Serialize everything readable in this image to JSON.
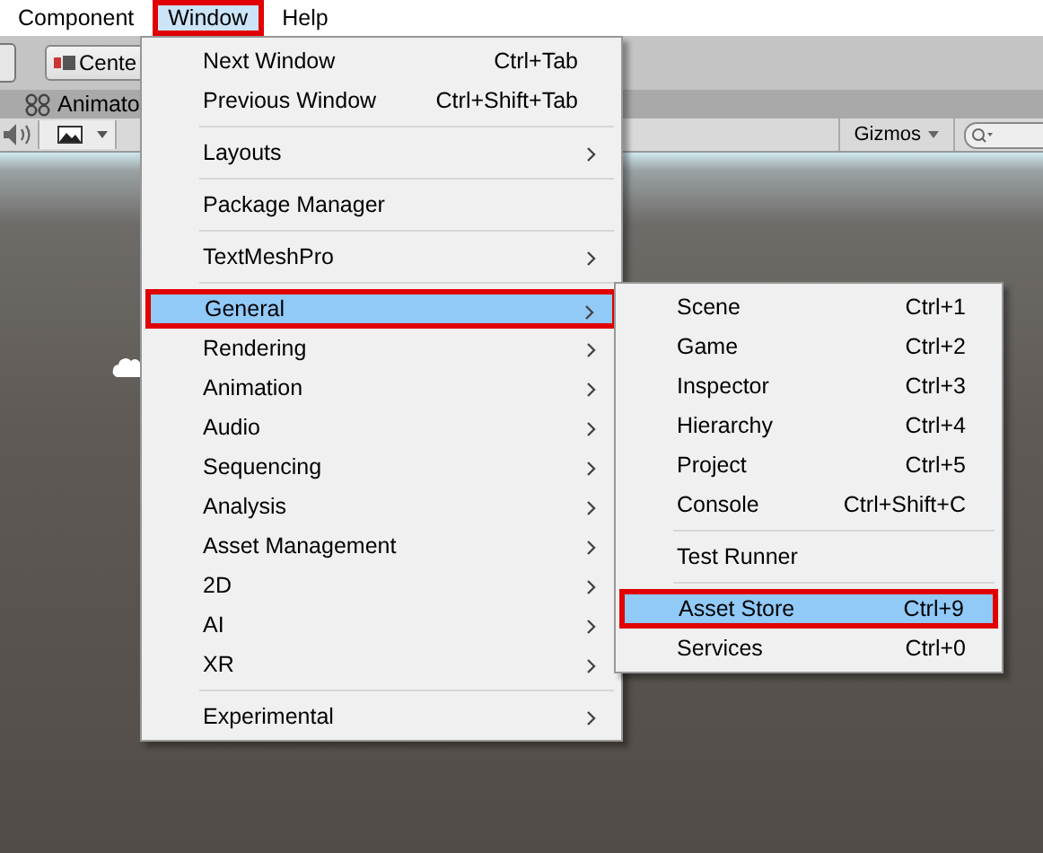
{
  "menubar": [
    {
      "label": "Component",
      "selected": false,
      "highlighted": false
    },
    {
      "label": "Window",
      "selected": true,
      "highlighted": true
    },
    {
      "label": "Help",
      "selected": false,
      "highlighted": false
    }
  ],
  "toolbar": {
    "pivot_button": "Cente"
  },
  "tab": {
    "label": "Animato"
  },
  "scene_toolbar": {
    "gizmos": "Gizmos"
  },
  "menu": {
    "groups": [
      [
        {
          "label": "Next Window",
          "shortcut": "Ctrl+Tab",
          "submenu": false,
          "selected": false,
          "highlighted": false
        },
        {
          "label": "Previous Window",
          "shortcut": "Ctrl+Shift+Tab",
          "submenu": false,
          "selected": false,
          "highlighted": false
        }
      ],
      [
        {
          "label": "Layouts",
          "submenu": true,
          "selected": false,
          "highlighted": false
        }
      ],
      [
        {
          "label": "Package Manager",
          "submenu": false,
          "selected": false,
          "highlighted": false
        }
      ],
      [
        {
          "label": "TextMeshPro",
          "submenu": true,
          "selected": false,
          "highlighted": false
        }
      ],
      [
        {
          "label": "General",
          "submenu": true,
          "selected": true,
          "highlighted": true
        },
        {
          "label": "Rendering",
          "submenu": true,
          "selected": false,
          "highlighted": false
        },
        {
          "label": "Animation",
          "submenu": true,
          "selected": false,
          "highlighted": false
        },
        {
          "label": "Audio",
          "submenu": true,
          "selected": false,
          "highlighted": false
        },
        {
          "label": "Sequencing",
          "submenu": true,
          "selected": false,
          "highlighted": false
        },
        {
          "label": "Analysis",
          "submenu": true,
          "selected": false,
          "highlighted": false
        },
        {
          "label": "Asset Management",
          "submenu": true,
          "selected": false,
          "highlighted": false
        },
        {
          "label": "2D",
          "submenu": true,
          "selected": false,
          "highlighted": false
        },
        {
          "label": "AI",
          "submenu": true,
          "selected": false,
          "highlighted": false
        },
        {
          "label": "XR",
          "submenu": true,
          "selected": false,
          "highlighted": false
        }
      ],
      [
        {
          "label": "Experimental",
          "submenu": true,
          "selected": false,
          "highlighted": false
        }
      ]
    ]
  },
  "submenu": {
    "groups": [
      [
        {
          "label": "Scene",
          "shortcut": "Ctrl+1",
          "selected": false,
          "highlighted": false
        },
        {
          "label": "Game",
          "shortcut": "Ctrl+2",
          "selected": false,
          "highlighted": false
        },
        {
          "label": "Inspector",
          "shortcut": "Ctrl+3",
          "selected": false,
          "highlighted": false
        },
        {
          "label": "Hierarchy",
          "shortcut": "Ctrl+4",
          "selected": false,
          "highlighted": false
        },
        {
          "label": "Project",
          "shortcut": "Ctrl+5",
          "selected": false,
          "highlighted": false
        },
        {
          "label": "Console",
          "shortcut": "Ctrl+Shift+C",
          "selected": false,
          "highlighted": false
        }
      ],
      [
        {
          "label": "Test Runner",
          "selected": false,
          "highlighted": false
        }
      ],
      [
        {
          "label": "Asset Store",
          "shortcut": "Ctrl+9",
          "selected": true,
          "highlighted": true
        },
        {
          "label": "Services",
          "shortcut": "Ctrl+0",
          "selected": false,
          "highlighted": false
        }
      ]
    ]
  }
}
